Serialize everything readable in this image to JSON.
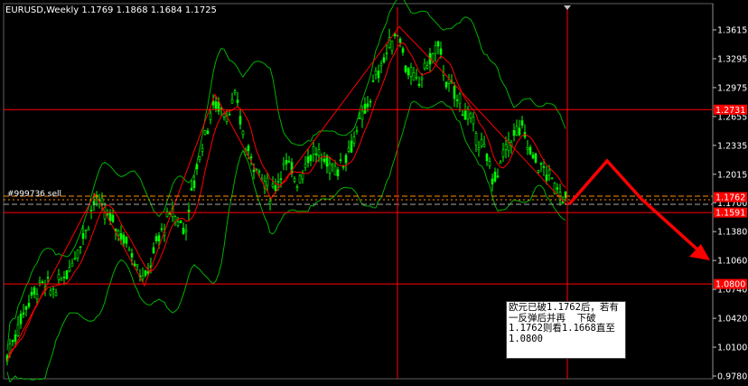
{
  "header": {
    "symbol": "EURUSD,Weekly",
    "ohlc": "1.1769 1.1868 1.1684 1.1725"
  },
  "order_label": "#999736 sell",
  "note": "欧元已破1.1762后，若有\n一反弹后并再  下破\n1.1762则看1.1668直至\n1.0800",
  "price_axis": {
    "ticks": [
      "1.3615",
      "1.3295",
      "1.2975",
      "1.2655",
      "1.2335",
      "1.2015",
      "1.1700",
      "1.1380",
      "1.1060",
      "1.0740",
      "1.0420",
      "1.0100",
      "0.9780"
    ],
    "tick_values": [
      1.3615,
      1.3295,
      1.2975,
      1.2655,
      1.2335,
      1.2015,
      1.17,
      1.138,
      1.106,
      1.074,
      1.042,
      1.01,
      0.978
    ]
  },
  "levels": [
    {
      "label": "1.2731",
      "price": 1.2731,
      "kind": "hline"
    },
    {
      "label": "1.1762",
      "price": 1.1762,
      "kind": "order"
    },
    {
      "label": "1.1591",
      "price": 1.1591,
      "kind": "hline"
    },
    {
      "label": "1.0800",
      "price": 1.08,
      "kind": "hline"
    }
  ],
  "colors": {
    "background": "#000000",
    "candles": "#00ff00",
    "bands": "#00b000",
    "lines": "#ff0000",
    "arrow": "#ff0000",
    "label_bg": "#ff0000",
    "label_text": "#ffffff"
  }
}
